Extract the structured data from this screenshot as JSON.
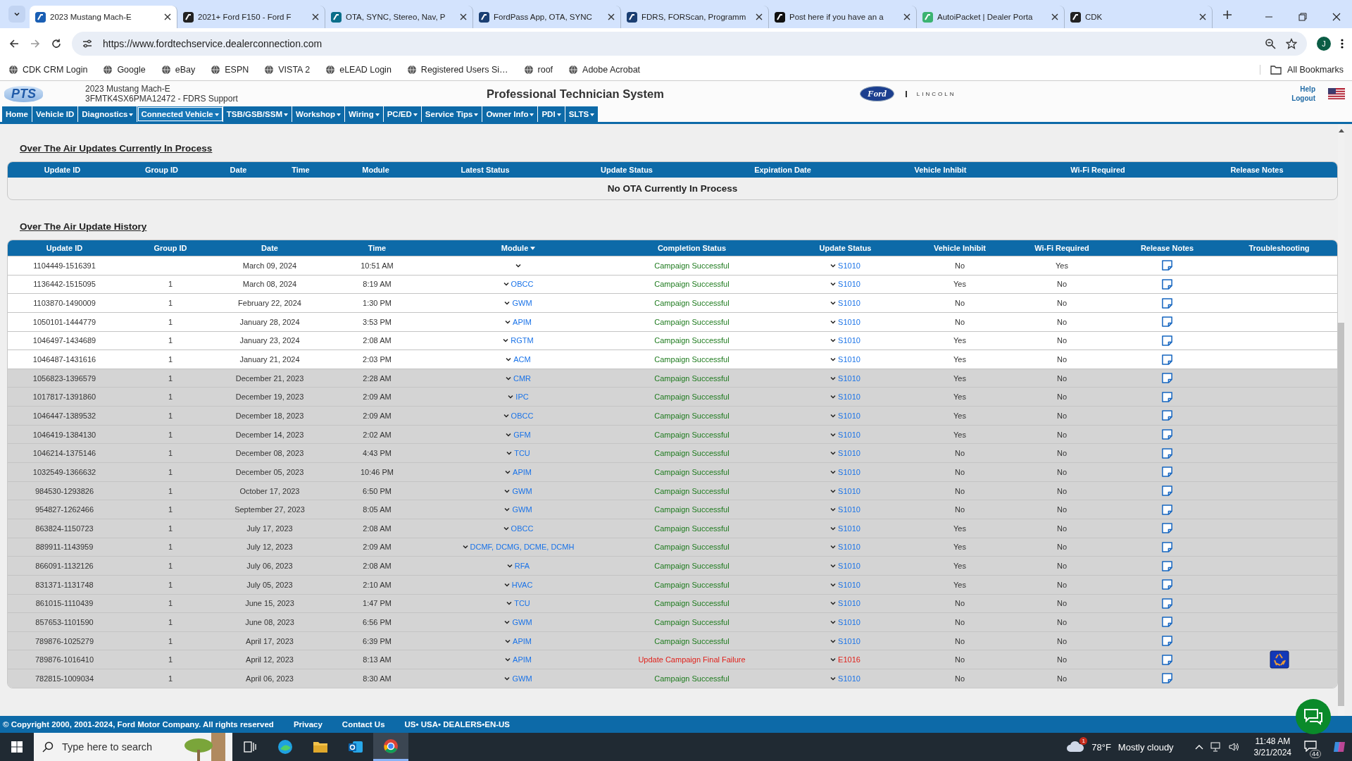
{
  "browser": {
    "tabs": [
      {
        "title": "2023 Mustang Mach-E",
        "selected": true
      },
      {
        "title": "2021+ Ford F150 - Ford F",
        "selected": false
      },
      {
        "title": "OTA, SYNC, Stereo, Nav, P",
        "selected": false
      },
      {
        "title": "FordPass App, OTA, SYNC",
        "selected": false
      },
      {
        "title": "FDRS, FORScan, Programm",
        "selected": false
      },
      {
        "title": "Post here if you have an a",
        "selected": false
      },
      {
        "title": "AutoiPacket | Dealer Porta",
        "selected": false
      },
      {
        "title": "CDK",
        "selected": false
      }
    ],
    "address": "https://www.fordtechservice.dealerconnection.com",
    "profile_initial": "J",
    "bookmarks": [
      "CDK CRM Login",
      "Google",
      "eBay",
      "ESPN",
      "VISTA 2",
      "eLEAD Login",
      "Registered Users Si…",
      "roof",
      "Adobe Acrobat"
    ],
    "all_bookmarks": "All Bookmarks"
  },
  "header": {
    "logo_text": "PTS",
    "vehicle": "2023 Mustang Mach-E",
    "vin_line": "3FMTK4SX6PMA12472 - FDRS Support",
    "title": "Professional Technician System",
    "brands": [
      "Ford",
      "LINCOLN"
    ],
    "links": [
      "Help",
      "Logout"
    ]
  },
  "nav": [
    {
      "label": "Home",
      "menu": false,
      "selected": false
    },
    {
      "label": "Vehicle ID",
      "menu": false,
      "selected": false
    },
    {
      "label": "Diagnostics",
      "menu": true,
      "selected": false
    },
    {
      "label": "Connected Vehicle",
      "menu": true,
      "selected": true
    },
    {
      "label": "TSB/GSB/SSM",
      "menu": true,
      "selected": false
    },
    {
      "label": "Workshop",
      "menu": true,
      "selected": false
    },
    {
      "label": "Wiring",
      "menu": true,
      "selected": false
    },
    {
      "label": "PC/ED",
      "menu": true,
      "selected": false
    },
    {
      "label": "Service Tips",
      "menu": true,
      "selected": false
    },
    {
      "label": "Owner Info",
      "menu": true,
      "selected": false
    },
    {
      "label": "PDI",
      "menu": true,
      "selected": false
    },
    {
      "label": "SLTS",
      "menu": true,
      "selected": false
    }
  ],
  "in_process": {
    "title": "Over The Air Updates Currently In Process",
    "columns": [
      "Update ID",
      "Group ID",
      "Date",
      "Time",
      "Module",
      "Latest Status",
      "Update Status",
      "Expiration Date",
      "Vehicle Inhibit",
      "Wi-Fi Required",
      "Release Notes"
    ],
    "empty_message": "No OTA Currently In Process"
  },
  "history": {
    "title": "Over The Air Update History",
    "columns": [
      {
        "label": "Update ID",
        "sorted": false
      },
      {
        "label": "Group ID",
        "sorted": false
      },
      {
        "label": "Date",
        "sorted": false
      },
      {
        "label": "Time",
        "sorted": false
      },
      {
        "label": "Module",
        "sorted": true
      },
      {
        "label": "Completion Status",
        "sorted": false
      },
      {
        "label": "Update Status",
        "sorted": false
      },
      {
        "label": "Vehicle Inhibit",
        "sorted": false
      },
      {
        "label": "Wi-Fi Required",
        "sorted": false
      },
      {
        "label": "Release Notes",
        "sorted": false
      },
      {
        "label": "Troubleshooting",
        "sorted": false
      }
    ],
    "rows": [
      {
        "update_id": "1104449-1516391",
        "date": "March 09, 2024",
        "time": "10:51 AM",
        "completion": "Campaign Successful",
        "failed": false,
        "update_status": "S1010",
        "vehicle_inhibit": "No",
        "wifi_required": "Yes",
        "troubleshooting": false,
        "shaded": false
      },
      {
        "update_id": "1136442-1515095",
        "group_id": "1",
        "date": "March 08, 2024",
        "time": "8:19 AM",
        "module": "OBCC",
        "completion": "Campaign Successful",
        "failed": false,
        "update_status": "S1010",
        "vehicle_inhibit": "Yes",
        "wifi_required": "No",
        "troubleshooting": false,
        "shaded": false
      },
      {
        "update_id": "1103870-1490009",
        "group_id": "1",
        "date": "February 22, 2024",
        "time": "1:30 PM",
        "module": "GWM",
        "completion": "Campaign Successful",
        "failed": false,
        "update_status": "S1010",
        "vehicle_inhibit": "No",
        "wifi_required": "No",
        "troubleshooting": false,
        "shaded": false
      },
      {
        "update_id": "1050101-1444779",
        "group_id": "1",
        "date": "January 28, 2024",
        "time": "3:53 PM",
        "module": "APIM",
        "completion": "Campaign Successful",
        "failed": false,
        "update_status": "S1010",
        "vehicle_inhibit": "No",
        "wifi_required": "No",
        "troubleshooting": false,
        "shaded": false
      },
      {
        "update_id": "1046497-1434689",
        "group_id": "1",
        "date": "January 23, 2024",
        "time": "2:08 AM",
        "module": "RGTM",
        "completion": "Campaign Successful",
        "failed": false,
        "update_status": "S1010",
        "vehicle_inhibit": "Yes",
        "wifi_required": "No",
        "troubleshooting": false,
        "shaded": false
      },
      {
        "update_id": "1046487-1431616",
        "group_id": "1",
        "date": "January 21, 2024",
        "time": "2:03 PM",
        "module": "ACM",
        "completion": "Campaign Successful",
        "failed": false,
        "update_status": "S1010",
        "vehicle_inhibit": "Yes",
        "wifi_required": "No",
        "troubleshooting": false,
        "shaded": false
      },
      {
        "update_id": "1056823-1396579",
        "group_id": "1",
        "date": "December 21, 2023",
        "time": "2:28 AM",
        "module": "CMR",
        "completion": "Campaign Successful",
        "failed": false,
        "update_status": "S1010",
        "vehicle_inhibit": "Yes",
        "wifi_required": "No",
        "troubleshooting": false,
        "shaded": true
      },
      {
        "update_id": "1017817-1391860",
        "group_id": "1",
        "date": "December 19, 2023",
        "time": "2:09 AM",
        "module": "IPC",
        "completion": "Campaign Successful",
        "failed": false,
        "update_status": "S1010",
        "vehicle_inhibit": "Yes",
        "wifi_required": "No",
        "troubleshooting": false,
        "shaded": true
      },
      {
        "update_id": "1046447-1389532",
        "group_id": "1",
        "date": "December 18, 2023",
        "time": "2:09 AM",
        "module": "OBCC",
        "completion": "Campaign Successful",
        "failed": false,
        "update_status": "S1010",
        "vehicle_inhibit": "Yes",
        "wifi_required": "No",
        "troubleshooting": false,
        "shaded": true
      },
      {
        "update_id": "1046419-1384130",
        "group_id": "1",
        "date": "December 14, 2023",
        "time": "2:02 AM",
        "module": "GFM",
        "completion": "Campaign Successful",
        "failed": false,
        "update_status": "S1010",
        "vehicle_inhibit": "Yes",
        "wifi_required": "No",
        "troubleshooting": false,
        "shaded": true
      },
      {
        "update_id": "1046214-1375146",
        "group_id": "1",
        "date": "December 08, 2023",
        "time": "4:43 PM",
        "module": "TCU",
        "completion": "Campaign Successful",
        "failed": false,
        "update_status": "S1010",
        "vehicle_inhibit": "No",
        "wifi_required": "No",
        "troubleshooting": false,
        "shaded": true
      },
      {
        "update_id": "1032549-1366632",
        "group_id": "1",
        "date": "December 05, 2023",
        "time": "10:46 PM",
        "module": "APIM",
        "completion": "Campaign Successful",
        "failed": false,
        "update_status": "S1010",
        "vehicle_inhibit": "No",
        "wifi_required": "No",
        "troubleshooting": false,
        "shaded": true
      },
      {
        "update_id": "984530-1293826",
        "group_id": "1",
        "date": "October 17, 2023",
        "time": "6:50 PM",
        "module": "GWM",
        "completion": "Campaign Successful",
        "failed": false,
        "update_status": "S1010",
        "vehicle_inhibit": "No",
        "wifi_required": "No",
        "troubleshooting": false,
        "shaded": true
      },
      {
        "update_id": "954827-1262466",
        "group_id": "1",
        "date": "September 27, 2023",
        "time": "8:05 AM",
        "module": "GWM",
        "completion": "Campaign Successful",
        "failed": false,
        "update_status": "S1010",
        "vehicle_inhibit": "No",
        "wifi_required": "No",
        "troubleshooting": false,
        "shaded": true
      },
      {
        "update_id": "863824-1150723",
        "group_id": "1",
        "date": "July 17, 2023",
        "time": "2:08 AM",
        "module": "OBCC",
        "completion": "Campaign Successful",
        "failed": false,
        "update_status": "S1010",
        "vehicle_inhibit": "Yes",
        "wifi_required": "No",
        "troubleshooting": false,
        "shaded": true
      },
      {
        "update_id": "889911-1143959",
        "group_id": "1",
        "date": "July 12, 2023",
        "time": "2:09 AM",
        "module": "DCMF, DCMG, DCME, DCMH",
        "completion": "Campaign Successful",
        "failed": false,
        "update_status": "S1010",
        "vehicle_inhibit": "Yes",
        "wifi_required": "No",
        "troubleshooting": false,
        "shaded": true
      },
      {
        "update_id": "866091-1132126",
        "group_id": "1",
        "date": "July 06, 2023",
        "time": "2:08 AM",
        "module": "RFA",
        "completion": "Campaign Successful",
        "failed": false,
        "update_status": "S1010",
        "vehicle_inhibit": "Yes",
        "wifi_required": "No",
        "troubleshooting": false,
        "shaded": true
      },
      {
        "update_id": "831371-1131748",
        "group_id": "1",
        "date": "July 05, 2023",
        "time": "2:10 AM",
        "module": "HVAC",
        "completion": "Campaign Successful",
        "failed": false,
        "update_status": "S1010",
        "vehicle_inhibit": "Yes",
        "wifi_required": "No",
        "troubleshooting": false,
        "shaded": true
      },
      {
        "update_id": "861015-1110439",
        "group_id": "1",
        "date": "June 15, 2023",
        "time": "1:47 PM",
        "module": "TCU",
        "completion": "Campaign Successful",
        "failed": false,
        "update_status": "S1010",
        "vehicle_inhibit": "No",
        "wifi_required": "No",
        "troubleshooting": false,
        "shaded": true
      },
      {
        "update_id": "857653-1101590",
        "group_id": "1",
        "date": "June 08, 2023",
        "time": "6:56 PM",
        "module": "GWM",
        "completion": "Campaign Successful",
        "failed": false,
        "update_status": "S1010",
        "vehicle_inhibit": "No",
        "wifi_required": "No",
        "troubleshooting": false,
        "shaded": true
      },
      {
        "update_id": "789876-1025279",
        "group_id": "1",
        "date": "April 17, 2023",
        "time": "6:39 PM",
        "module": "APIM",
        "completion": "Campaign Successful",
        "failed": false,
        "update_status": "S1010",
        "vehicle_inhibit": "No",
        "wifi_required": "No",
        "troubleshooting": false,
        "shaded": true
      },
      {
        "update_id": "789876-1016410",
        "group_id": "1",
        "date": "April 12, 2023",
        "time": "8:13 AM",
        "module": "APIM",
        "completion": "Update Campaign Final Failure",
        "failed": true,
        "update_status": "E1016",
        "vehicle_inhibit": "No",
        "wifi_required": "No",
        "troubleshooting": true,
        "shaded": true
      },
      {
        "update_id": "782815-1009034",
        "group_id": "1",
        "date": "April 06, 2023",
        "time": "8:30 AM",
        "module": "GWM",
        "completion": "Campaign Successful",
        "failed": false,
        "update_status": "S1010",
        "vehicle_inhibit": "No",
        "wifi_required": "No",
        "troubleshooting": false,
        "shaded": true
      }
    ]
  },
  "footer": {
    "copyright": "© Copyright 2000, 2001-2024, Ford Motor Company. All rights reserved",
    "links": [
      "Privacy",
      "Contact Us"
    ],
    "locale": "US• USA• DEALERS•EN-US"
  },
  "taskbar": {
    "search": {
      "placeholder": "Type here to search"
    },
    "apps": [
      {
        "selected": false
      },
      {
        "selected": false
      },
      {
        "selected": false
      },
      {
        "selected": false
      },
      {
        "selected": true
      }
    ],
    "weather_badge": "1",
    "temperature": "78°F",
    "weather": "Mostly cloudy",
    "time": "11:48 AM",
    "date": "3/21/2024",
    "notifications": "44"
  }
}
